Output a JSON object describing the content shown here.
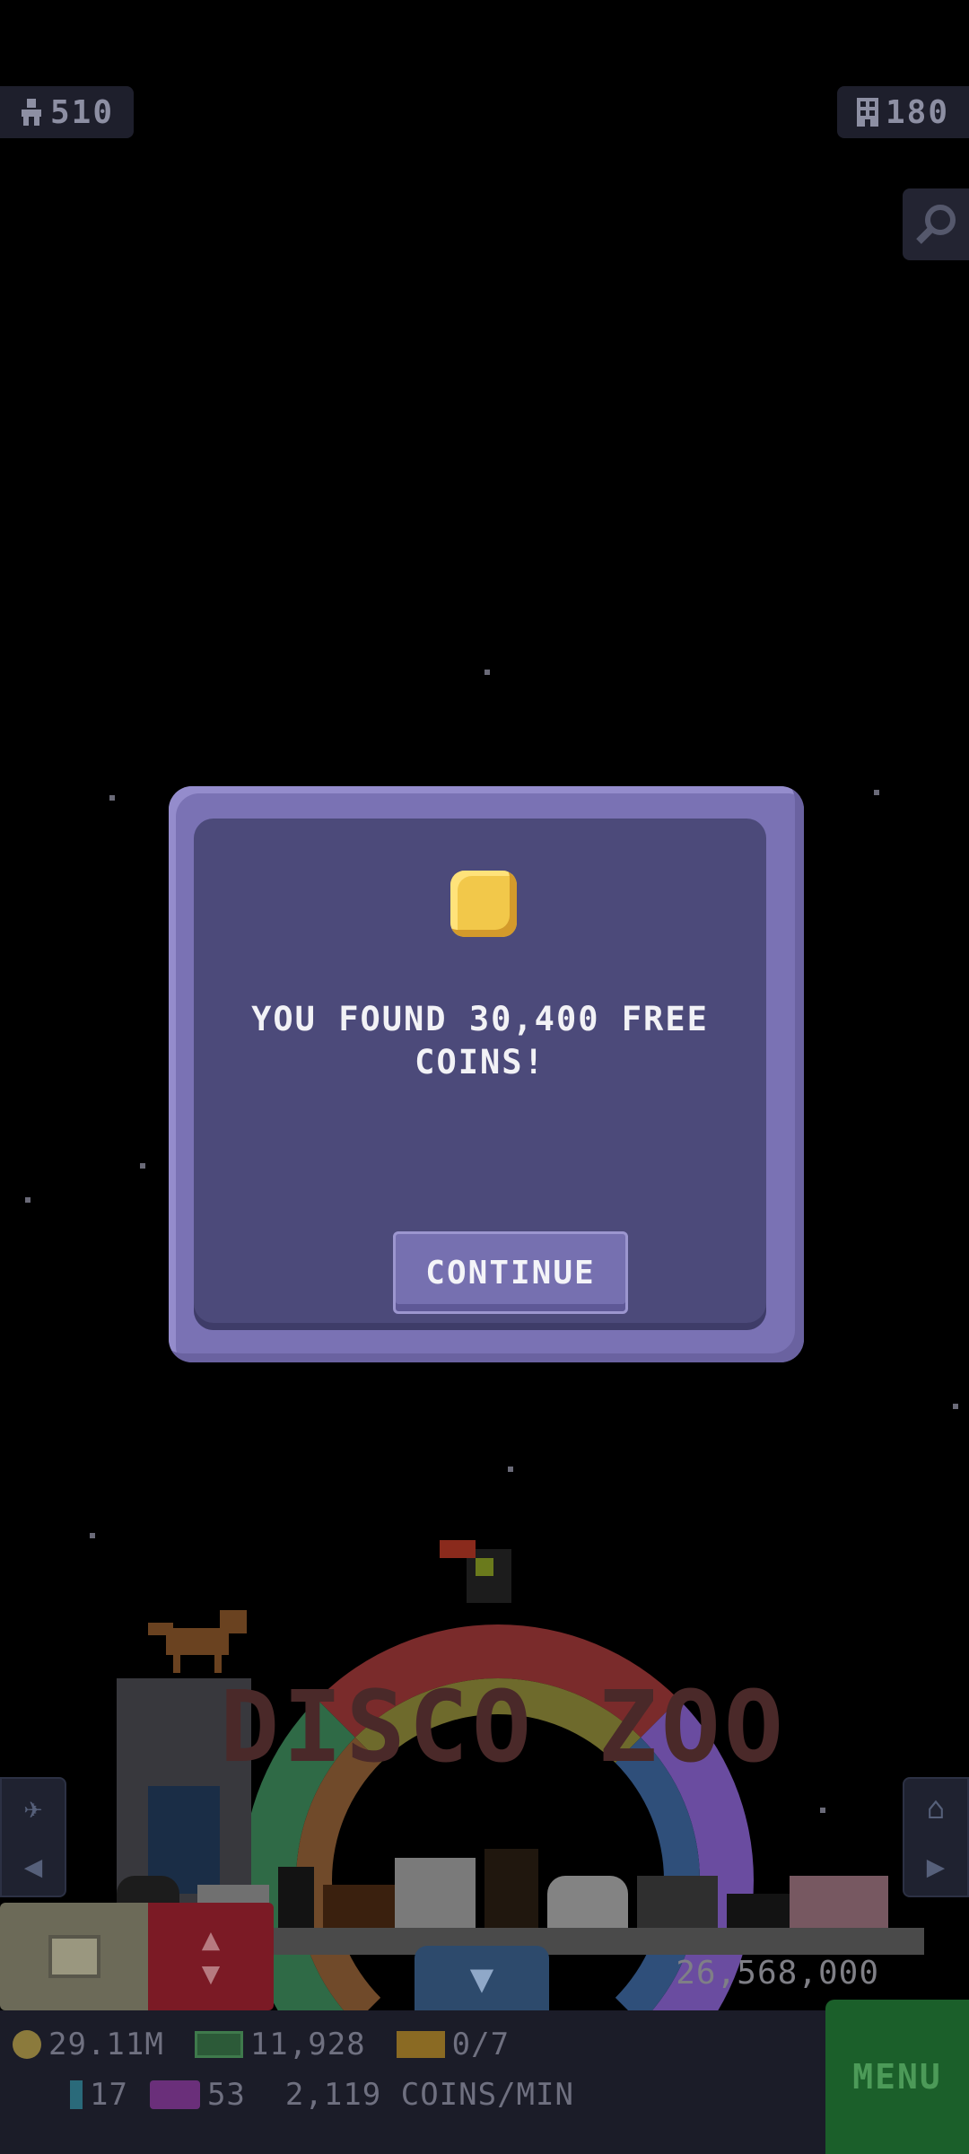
{
  "hud": {
    "visitors": "510",
    "buildings": "180",
    "icons": {
      "visitors": "person-icon",
      "buildings": "building-icon",
      "search": "magnifier-icon"
    }
  },
  "dialog": {
    "message": "YOU FOUND 30,400 FREE COINS!",
    "continue_label": "CONTINUE",
    "icon": "coin-icon"
  },
  "scene": {
    "logo": "DISCO ZOO",
    "visitor_count": "26,568,000"
  },
  "footer": {
    "coins": "29.11M",
    "cash": "11,928",
    "tickets": "0/7",
    "gems": "17",
    "tv": "53",
    "rate": "2,119 COINS/MIN",
    "menu_label": "MENU"
  },
  "colors": {
    "background": "#000000",
    "dialog_frame": "#7a72b4",
    "dialog_body": "#4c4a7a",
    "coin": "#f2c84a",
    "menu": "#1b5f2a"
  }
}
